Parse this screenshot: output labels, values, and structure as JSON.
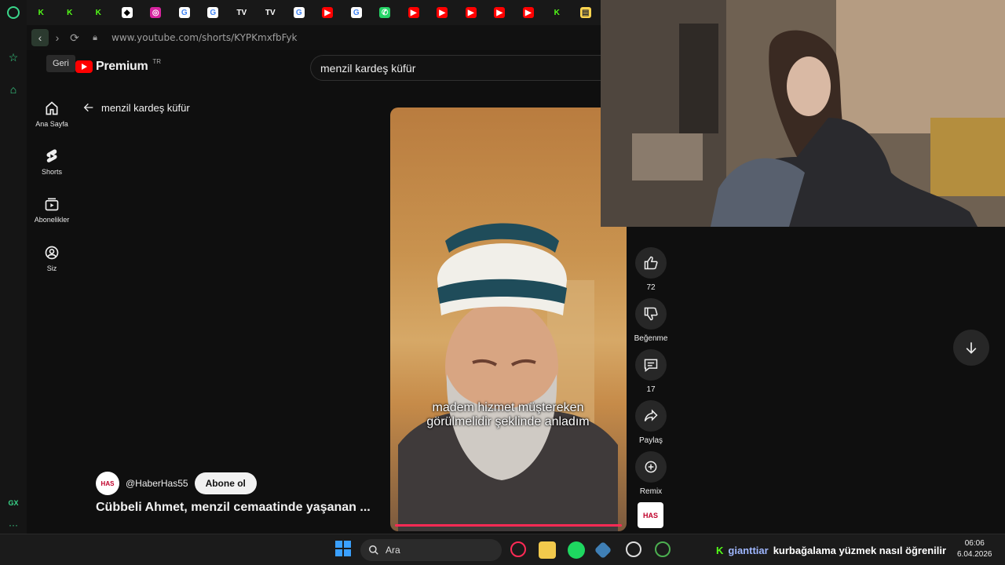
{
  "browser": {
    "url": "www.youtube.com/shorts/KYPKmxfbFyk",
    "back_tooltip": "Geri",
    "sidebar_bottom_label": "GX",
    "tab_favicons": [
      "kick",
      "kick",
      "kick",
      "app",
      "instagram",
      "google",
      "google",
      "tv",
      "tv",
      "google",
      "youtube",
      "google",
      "whatsapp",
      "youtube",
      "youtube",
      "youtube",
      "youtube",
      "youtube",
      "kick",
      "file"
    ]
  },
  "youtube": {
    "logo_text": "Premium",
    "region": "TR",
    "search_value": "menzil kardeş küfür",
    "query_header": "menzil kardeş küfür",
    "sidebar": [
      {
        "label": "Ana Sayfa",
        "icon": "home-icon"
      },
      {
        "label": "Shorts",
        "icon": "shorts-icon"
      },
      {
        "label": "Abonelikler",
        "icon": "subscriptions-icon"
      },
      {
        "label": "Siz",
        "icon": "account-icon"
      }
    ],
    "video": {
      "caption": "madem hizmet müştereken görülmelidir şeklinde anladım",
      "channel_handle": "@HaberHas55",
      "channel_avatar_text": "HAS",
      "subscribe_label": "Abone ol",
      "title": "Cübbeli Ahmet, menzil cemaatinde yaşanan ..."
    },
    "actions": {
      "like_count": "72",
      "dislike_label": "Beğenme",
      "comment_count": "17",
      "share_label": "Paylaş",
      "remix_label": "Remix"
    }
  },
  "taskbar": {
    "search_placeholder": "Ara",
    "chat_user": "gianttiar",
    "chat_message": "kurbağalama yüzmek nasıl öğrenilir",
    "time": "06:06",
    "date": "6.04.2026"
  },
  "colors": {
    "accent": "#ff0000",
    "opera_green": "#3ad68a",
    "kick_green": "#53fc18"
  }
}
